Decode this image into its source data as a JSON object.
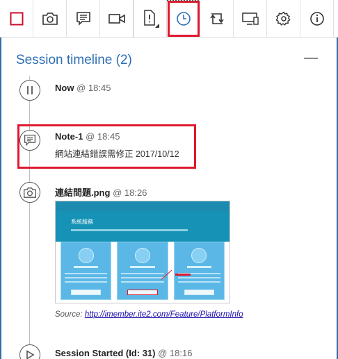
{
  "toolbar": {
    "buttons": [
      {
        "name": "stop-recording-button",
        "icon": "stop-square-icon"
      },
      {
        "name": "screenshot-button",
        "icon": "camera-icon"
      },
      {
        "name": "add-note-button",
        "icon": "note-icon"
      },
      {
        "name": "video-button",
        "icon": "video-camera-icon"
      },
      {
        "name": "issue-button",
        "icon": "issue-document-icon"
      },
      {
        "name": "timeline-button",
        "icon": "clock-icon",
        "active": true
      },
      {
        "name": "switch-button",
        "icon": "swap-icon"
      },
      {
        "name": "device-button",
        "icon": "devices-icon"
      },
      {
        "name": "settings-button",
        "icon": "gear-icon"
      },
      {
        "name": "info-button",
        "icon": "info-icon"
      }
    ]
  },
  "panel": {
    "title": "Session timeline (2)"
  },
  "timeline": [
    {
      "kind": "pause",
      "icon": "pause-icon",
      "title": "Now",
      "time": "@ 18:45"
    },
    {
      "kind": "note",
      "icon": "note-icon",
      "title": "Note-1",
      "time": "@ 18:45",
      "text": "網站連結錯誤需修正 2017/10/12"
    },
    {
      "kind": "screenshot",
      "icon": "camera-icon",
      "title": "連結問題.png",
      "time": "@ 18:26",
      "thumbnail": {
        "hero_title": "系統服務"
      },
      "source_label": "Source:",
      "source_url": "http://imember.ite2.com/Feature/PlatformInfo"
    },
    {
      "kind": "start",
      "icon": "play-icon",
      "title": "Session Started (Id: 31)",
      "time": "@ 18:16"
    }
  ],
  "colors": {
    "accent": "#2e6fb4",
    "highlight": "#e0182d",
    "stop": "#c8102e"
  }
}
